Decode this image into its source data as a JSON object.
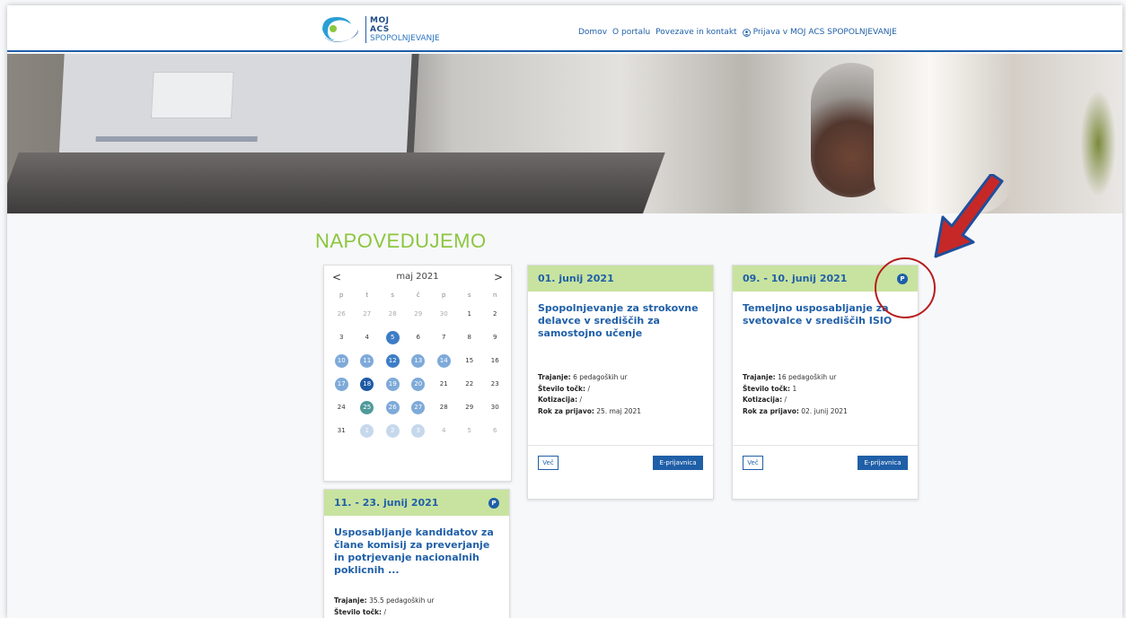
{
  "header": {
    "logo": {
      "line1": "MOJ",
      "line2": "ACS",
      "line3": "SPOPOLNJEVANJE"
    },
    "nav": [
      {
        "label": "Domov"
      },
      {
        "label": "O portalu"
      },
      {
        "label": "Povezave in kontakt"
      },
      {
        "label": "Prijava v MOJ ACS SPOPOLNJEVANJE",
        "icon": "user-icon"
      }
    ]
  },
  "section": {
    "title": "NAPOVEDUJEMO"
  },
  "calendar": {
    "month_label": "maj 2021",
    "prev": "<",
    "next": ">",
    "weekdays": [
      "p",
      "t",
      "s",
      "č",
      "p",
      "s",
      "n"
    ],
    "weeks": [
      [
        [
          "26",
          "muted"
        ],
        [
          "27",
          "muted"
        ],
        [
          "28",
          "muted"
        ],
        [
          "29",
          "muted"
        ],
        [
          "30",
          "muted"
        ],
        [
          "1",
          ""
        ],
        [
          "2",
          ""
        ]
      ],
      [
        [
          "3",
          ""
        ],
        [
          "4",
          ""
        ],
        [
          "5",
          "ev2"
        ],
        [
          "6",
          ""
        ],
        [
          "7",
          ""
        ],
        [
          "8",
          ""
        ],
        [
          "9",
          ""
        ]
      ],
      [
        [
          "10",
          "ev1"
        ],
        [
          "11",
          "ev1"
        ],
        [
          "12",
          "ev2"
        ],
        [
          "13",
          "ev1"
        ],
        [
          "14",
          "ev1"
        ],
        [
          "15",
          ""
        ],
        [
          "16",
          ""
        ]
      ],
      [
        [
          "17",
          "ev1"
        ],
        [
          "18",
          "ev3"
        ],
        [
          "19",
          "ev1"
        ],
        [
          "20",
          "ev1"
        ],
        [
          "21",
          ""
        ],
        [
          "22",
          ""
        ],
        [
          "23",
          ""
        ]
      ],
      [
        [
          "24",
          ""
        ],
        [
          "25",
          "ev4"
        ],
        [
          "26",
          "ev1"
        ],
        [
          "27",
          "ev1"
        ],
        [
          "28",
          ""
        ],
        [
          "29",
          ""
        ],
        [
          "30",
          ""
        ]
      ],
      [
        [
          "31",
          ""
        ],
        [
          "1",
          "evl"
        ],
        [
          "2",
          "evl"
        ],
        [
          "3",
          "evl"
        ],
        [
          "4",
          "muted"
        ],
        [
          "5",
          "muted"
        ],
        [
          "6",
          "muted"
        ]
      ]
    ]
  },
  "cards": [
    {
      "date": "01. junij 2021",
      "badge": "",
      "title": "Spopolnjevanje za strokovne delavce v središčih za samostojno učenje",
      "trajanje_label": "Trajanje:",
      "trajanje": "6 pedagoških ur",
      "tocke_label": "Število točk:",
      "tocke": "/",
      "kotizacija_label": "Kotizacija:",
      "kotizacija": "/",
      "rok_label": "Rok za prijavo:",
      "rok": "25. maj 2021",
      "btn_more": "Več",
      "btn_apply": "E-prijavnica"
    },
    {
      "date": "09. - 10. junij 2021",
      "badge": "P",
      "title": "Temeljno usposabljanje za svetovalce v središčih ISIO",
      "trajanje_label": "Trajanje:",
      "trajanje": "16 pedagoških ur",
      "tocke_label": "Število točk:",
      "tocke": "1",
      "kotizacija_label": "Kotizacija:",
      "kotizacija": "/",
      "rok_label": "Rok za prijavo:",
      "rok": "02. junij 2021",
      "btn_more": "Več",
      "btn_apply": "E-prijavnica"
    },
    {
      "date": "11. - 23. junij 2021",
      "badge": "P",
      "title": "Usposabljanje kandidatov za člane komisij za preverjanje in potrjevanje nacionalnih poklicnih ...",
      "trajanje_label": "Trajanje:",
      "trajanje": "35.5 pedagoških ur",
      "tocke_label": "Število točk:",
      "tocke": "/"
    }
  ],
  "colors": {
    "brand_blue": "#1f5fa8",
    "accent_green": "#8cc63f",
    "card_header": "#c8e39f",
    "annotation_red": "#b71c1c"
  }
}
